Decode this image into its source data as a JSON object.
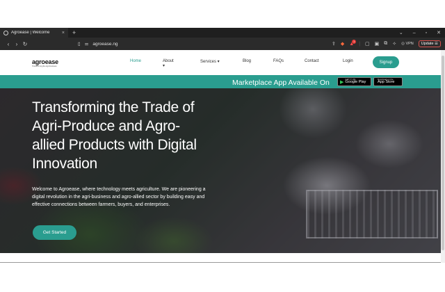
{
  "browser": {
    "tab_title": "Agroease | Welcome",
    "tab_close": "×",
    "new_tab": "+",
    "url": "agroease.ng",
    "vpn": "VPN",
    "update": "Update",
    "notif_count": "1"
  },
  "site": {
    "logo": "agroease",
    "logo_tagline": "Transforming the Agri-business",
    "nav": {
      "home": "Home",
      "about": "About ▾",
      "services": "Services ▾",
      "blog": "Blog",
      "faqs": "FAQs",
      "contact": "Contact",
      "login": "Login",
      "signup": "Signup"
    }
  },
  "banner": {
    "text": "Marketplace App Available On",
    "google_small": "GET IT ON",
    "google_large": "Google Play",
    "apple_small": "Download on the",
    "apple_large": "App Store"
  },
  "hero": {
    "title": "Transforming the Trade of Agri-Produce and Agro-allied Products with Digital Innovation",
    "description": "Welcome to Agroease, where technology meets agriculture. We are pioneering a digital revolution in the agri-business and agro-allied sector by building easy and effective connections between farmers, buyers, and enterprises.",
    "cta": "Get Started"
  },
  "colors": {
    "accent": "#2a9d8f",
    "chrome_dark": "#1f1f1f"
  }
}
